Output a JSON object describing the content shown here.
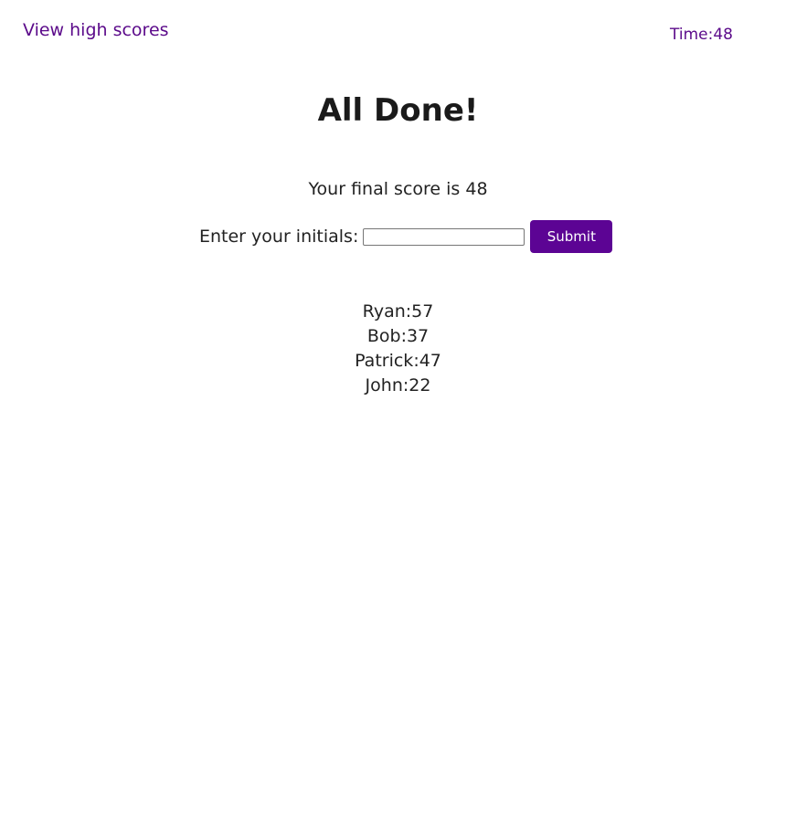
{
  "header": {
    "high_scores_link": "View high scores",
    "timer_label": "Time:",
    "timer_value": "48"
  },
  "main": {
    "title": "All Done!",
    "final_score_text": "Your final score is 48",
    "initials_label": "Enter your initials:",
    "initials_value": "",
    "submit_label": "Submit"
  },
  "high_scores": [
    "Ryan:57",
    "Bob:37",
    "Patrick:47",
    "John:22"
  ],
  "colors": {
    "accent": "#5c0494",
    "link": "#5b0a8a"
  }
}
